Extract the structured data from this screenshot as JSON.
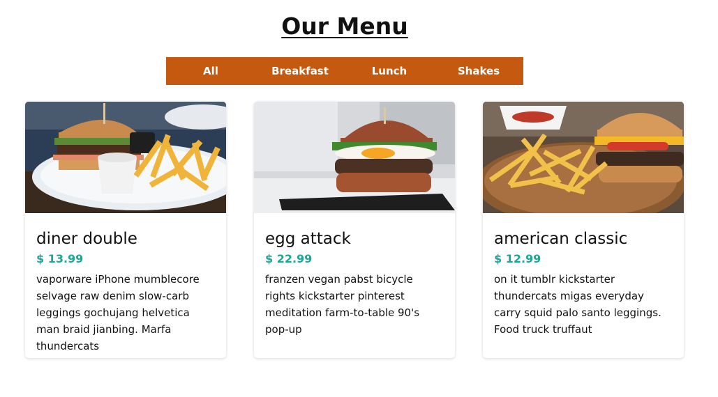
{
  "page": {
    "title": "Our Menu"
  },
  "filters": [
    {
      "label": "All"
    },
    {
      "label": "Breakfast"
    },
    {
      "label": "Lunch"
    },
    {
      "label": "Shakes"
    }
  ],
  "colors": {
    "filter_bar": "#c5590f",
    "price": "#1aa896"
  },
  "menu": [
    {
      "name": "diner double",
      "price": "$ 13.99",
      "description": "vaporware iPhone mumblecore selvage raw denim slow-carb leggings gochujang helvetica man braid jianbing. Marfa thundercats"
    },
    {
      "name": "egg attack",
      "price": "$ 22.99",
      "description": "franzen vegan pabst bicycle rights kickstarter pinterest meditation farm-to-table 90's pop-up"
    },
    {
      "name": "american classic",
      "price": "$ 12.99",
      "description": "on it tumblr kickstarter thundercats migas everyday carry squid palo santo leggings. Food truck truffaut"
    }
  ]
}
